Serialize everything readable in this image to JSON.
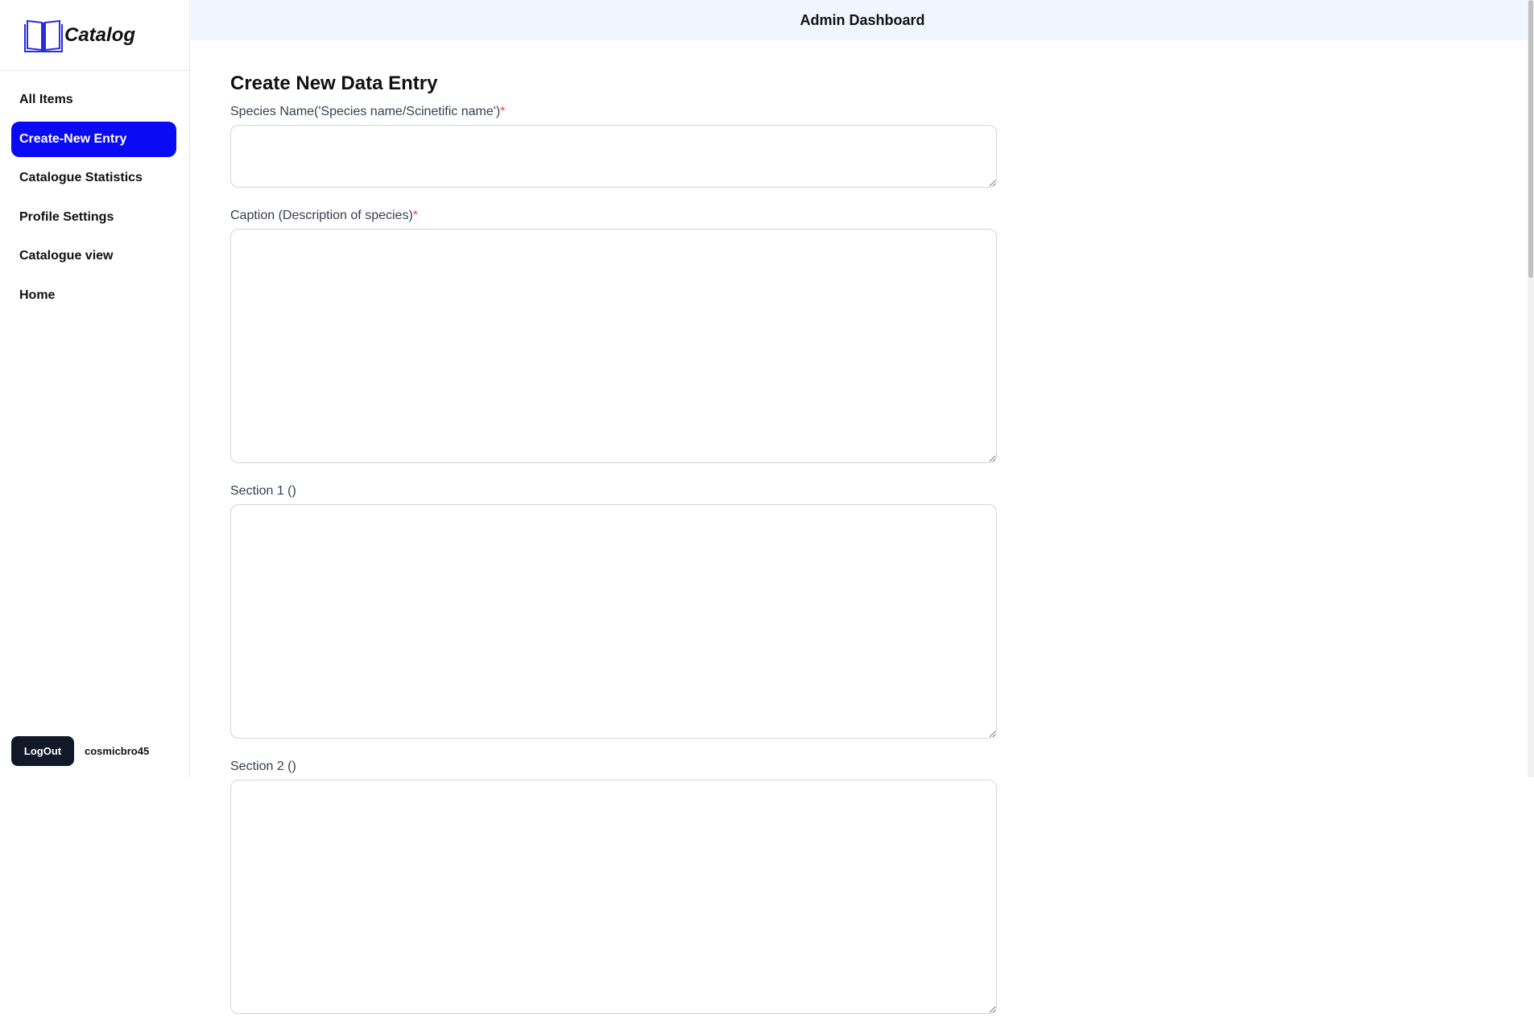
{
  "app": {
    "logo_text": "Catalog",
    "logo_icon": "open-book-icon",
    "header_title": "Admin Dashboard"
  },
  "sidebar": {
    "items": [
      {
        "label": "All Items",
        "active": false
      },
      {
        "label": "Create-New Entry",
        "active": true
      },
      {
        "label": "Catalogue Statistics",
        "active": false
      },
      {
        "label": "Profile Settings",
        "active": false
      },
      {
        "label": "Catalogue view",
        "active": false
      },
      {
        "label": "Home",
        "active": false
      }
    ],
    "logout_label": "LogOut",
    "username": "cosmicbro45"
  },
  "form": {
    "title": "Create New Data Entry",
    "fields": [
      {
        "label": "Species Name('Species name/Scinetific name')",
        "required": true,
        "value": ""
      },
      {
        "label": "Caption (Description of species)",
        "required": true,
        "value": ""
      },
      {
        "label": "Section 1 ()",
        "required": false,
        "value": ""
      },
      {
        "label": "Section 2 ()",
        "required": false,
        "value": ""
      }
    ],
    "required_marker": "*"
  },
  "colors": {
    "accent": "#0a0af5",
    "header_bg": "#eff6ff",
    "logout_bg": "#111827",
    "required": "#ef4444"
  }
}
